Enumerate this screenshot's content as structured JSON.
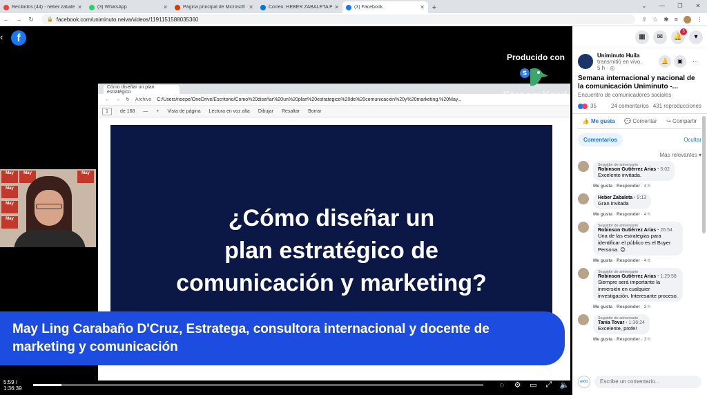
{
  "tabs": [
    {
      "title": "Recibidos (44) - heber.zabaleta@...",
      "color": "#ea4335",
      "active": false
    },
    {
      "title": "(3) WhatsApp",
      "color": "#25d366",
      "active": false
    },
    {
      "title": "Página principal de Microsoft Of...",
      "color": "#d83b01",
      "active": false
    },
    {
      "title": "Correo: HEBER ZABALETA PARRA...",
      "color": "#0078d4",
      "active": false
    },
    {
      "title": "(3) Facebook",
      "color": "#1877f2",
      "active": true
    }
  ],
  "address": {
    "url": "facebook.com/uniminuto.neiva/videos/1191151588035360"
  },
  "video": {
    "producido": "Producido con",
    "streamyard": "StreamYard",
    "inner": {
      "tab_title": "Cómo diseñar un plan estratégico",
      "archivo": "Archivo",
      "path": "C:/Users/noepe/OneDrive/Escritorio/Como%20diseñar%20un%20plan%20estrategico%20de%20comunicación%20y%20marketing.%20May...",
      "page": "1",
      "of": "de 168",
      "vista": "Vista de página",
      "lectura": "Lectura en voz alta",
      "dibujar": "Dibujar",
      "resaltar": "Resaltar",
      "borrar": "Borrar"
    },
    "slide_title_1": "¿Cómo diseñar un",
    "slide_title_2": "plan estratégico de",
    "slide_title_3": "comunicación y marketing?",
    "poster": "May",
    "lower_third_1": "May Ling Carabaño D'Cruz, Estratega, consultora internacional y docente de",
    "lower_third_2": "marketing y comunicación",
    "time": "5:59 / 1:36:39",
    "progress": 0.062
  },
  "panel": {
    "notif_count": "3",
    "page_name": "Uniminuto Huila",
    "page_sub": "transmitió en vivo.",
    "page_time": "5 h",
    "post_title": "Semana internacional y nacional de la comunicación Uniminuto -...",
    "post_desc": "Encuentro de comunicadores sociales",
    "reactions": "35",
    "comments_count": "24 comentarios",
    "views": "431 reproducciones",
    "like": "Me gusta",
    "comment": "Comentar",
    "share": "Compartir",
    "filter": "Comentarios",
    "hide": "Ocultar",
    "relevance": "Más relevantes",
    "composer": "Escribe un comentario...",
    "composer_avatar": "ARIO",
    "comments": [
      {
        "badge": "Seguidor de aniversario",
        "name": "Robinson Gutiérrez Arias",
        "time": "5:02",
        "text": "Excelente invitada.",
        "meta_like": "Me gusta",
        "meta_reply": "Responder",
        "meta_time": "4 h"
      },
      {
        "badge": "",
        "name": "Heber Zabaleta",
        "time": "9:13",
        "text": "Gran invitada",
        "meta_like": "Me gusta",
        "meta_reply": "Responder",
        "meta_time": "4 h"
      },
      {
        "badge": "Seguidor de aniversario",
        "name": "Robinson Gutiérrez Arias",
        "time": "26:54",
        "text": "Una de las estrategias para identificar el público es el Buyer Persona. 😊",
        "meta_like": "Me gusta",
        "meta_reply": "Responder",
        "meta_time": "4 h"
      },
      {
        "badge": "Seguidor de aniversario",
        "name": "Robinson Gutiérrez Arias",
        "time": "1:29:58",
        "text": "Siempre será importante la inmersión en cualquier investigación. Interesante proceso.",
        "meta_like": "Me gusta",
        "meta_reply": "Responder",
        "meta_time": "3 h"
      },
      {
        "badge": "Seguidor de aniversario",
        "name": "Tania Tovar",
        "time": "1:36:24",
        "text": "Excelente, profe!",
        "meta_like": "Me gusta",
        "meta_reply": "Responder",
        "meta_time": "3 h"
      }
    ]
  }
}
